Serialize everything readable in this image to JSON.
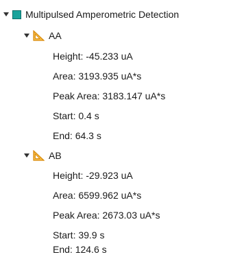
{
  "tree": {
    "root": {
      "label": "Multipulsed Amperometric Detection",
      "icon": "teal-square-icon",
      "color": "#1aa39c",
      "expanded": true
    },
    "peaks": [
      {
        "label": "AA",
        "icon": "peak-triangle-icon",
        "expanded": true,
        "properties": [
          "Height: -45.233 uA",
          "Area: 3193.935 uA*s",
          "Peak Area: 3183.147 uA*s",
          "Start: 0.4 s",
          "End: 64.3 s"
        ]
      },
      {
        "label": "AB",
        "icon": "peak-triangle-icon",
        "expanded": true,
        "properties": [
          "Height: -29.923 uA",
          "Area: 6599.962 uA*s",
          "Peak Area: 2673.03 uA*s",
          "Start: 39.9 s",
          "End: 124.6 s"
        ]
      }
    ]
  },
  "colors": {
    "method_icon": "#1aa39c",
    "peak_icon": "#f2a21a",
    "text": "#1a1a1a"
  }
}
